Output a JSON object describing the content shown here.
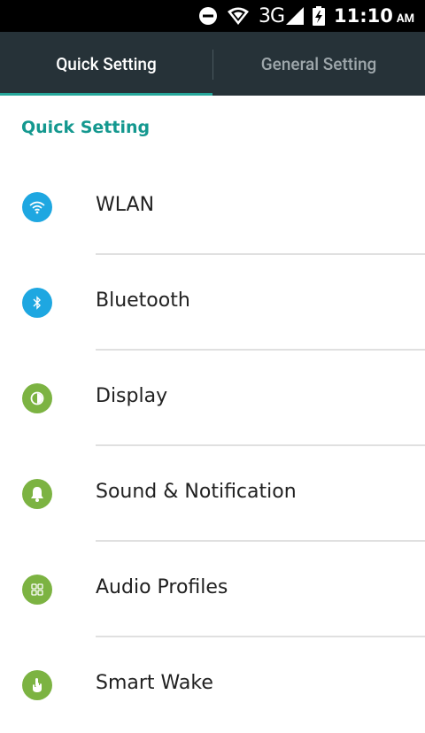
{
  "status_bar": {
    "network": "3G",
    "time": "11:10",
    "ampm": "AM",
    "icons": [
      "do-not-disturb-icon",
      "wifi-icon",
      "signal-icon",
      "battery-charging-icon"
    ]
  },
  "tabs": [
    {
      "label": "Quick Setting",
      "active": true
    },
    {
      "label": "General Setting",
      "active": false
    }
  ],
  "section_title": "Quick Setting",
  "items": [
    {
      "label": "WLAN",
      "icon": "wifi-icon",
      "color": "#1ea7e1"
    },
    {
      "label": "Bluetooth",
      "icon": "bluetooth-icon",
      "color": "#1ea7e1"
    },
    {
      "label": "Display",
      "icon": "display-icon",
      "color": "#7cb342"
    },
    {
      "label": "Sound & Notification",
      "icon": "bell-icon",
      "color": "#7cb342"
    },
    {
      "label": "Audio Profiles",
      "icon": "grid-icon",
      "color": "#7cb342"
    },
    {
      "label": "Smart Wake",
      "icon": "hand-icon",
      "color": "#7cb342"
    }
  ],
  "colors": {
    "accent": "#26a69a",
    "section_title": "#14988f",
    "tab_bar": "#263238"
  }
}
